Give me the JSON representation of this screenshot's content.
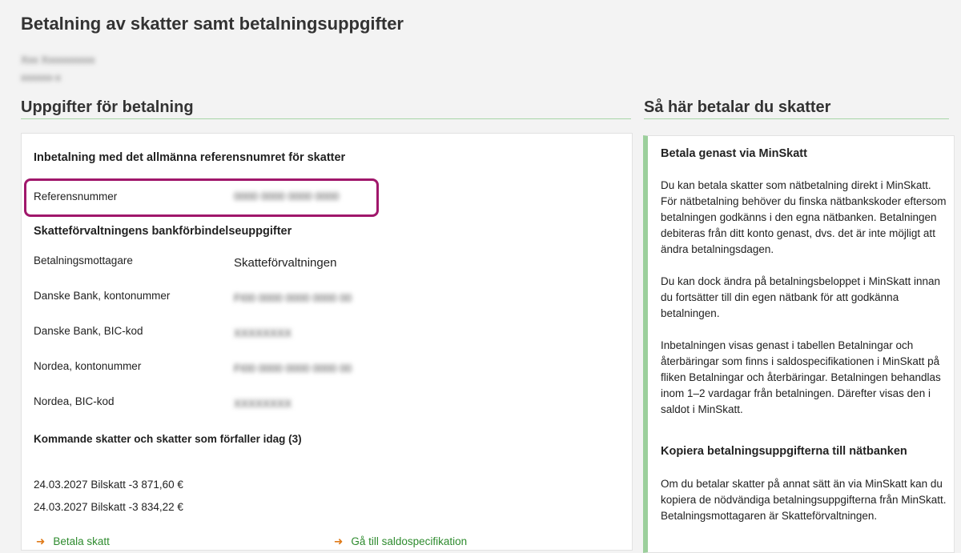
{
  "page": {
    "title": "Betalning av skatter samt betalningsuppgifter",
    "user_name_blurred": "Xxx Xxxxxxxxxx",
    "user_id_blurred": "xxxxxx-x"
  },
  "left": {
    "section_title": "Uppgifter för betalning",
    "reference_heading": "Inbetalning med det allmänna referensnumret för skatter",
    "reference_label": "Referensnummer",
    "reference_value_blurred": "0000 0000 0000 0000",
    "bank_heading": "Skatteförvaltningens bankförbindelseuppgifter",
    "bank_rows": [
      {
        "label": "Betalningsmottagare",
        "value": "Skatteförvaltningen"
      },
      {
        "label": "Danske Bank, kontonummer",
        "value": "FI00 0000 0000 0000 00"
      },
      {
        "label": "Danske Bank, BIC-kod",
        "value": "XXXXXXXX"
      },
      {
        "label": "Nordea, kontonummer",
        "value": "FI00 0000 0000 0000 00"
      },
      {
        "label": "Nordea, BIC-kod",
        "value": "XXXXXXXX"
      }
    ],
    "upcoming_heading": "Kommande skatter och skatter som förfaller idag (3)",
    "upcoming_items": [
      "24.03.2027 Bilskatt -3 871,60 €",
      "24.03.2027 Bilskatt -3 834,22 €"
    ],
    "links": [
      "Betala skatt",
      "Gå till saldospecifikation"
    ]
  },
  "right": {
    "section_title": "Så här betalar du skatter",
    "heading1": "Betala genast via MinSkatt",
    "para1": "Du kan betala skatter som nätbetalning direkt i MinSkatt. För nätbetalning behöver du finska nätbankskoder eftersom betalningen godkänns i den egna nätbanken. Betalningen debiteras från ditt konto genast, dvs. det är inte möjligt att ändra betalningsdagen.",
    "para2": "Du kan dock ändra på betalningsbeloppet i MinSkatt innan du fortsätter till din egen nätbank för att godkänna betalningen.",
    "para3": "Inbetalningen visas genast i tabellen Betalningar och återbäringar som finns i saldospecifikationen i MinSkatt på fliken Betalningar och återbäringar. Betalningen behandlas inom 1–2 vardagar från betalningen. Därefter visas den i saldot i MinSkatt.",
    "heading2": "Kopiera betalningsuppgifterna till nätbanken",
    "para4": "Om du betalar skatter på annat sätt än via MinSkatt kan du kopiera de nödvändiga betalningsuppgifterna från MinSkatt. Betalningsmottagaren är Skatteförvaltningen."
  },
  "colors": {
    "accent_green": "#9ccf9c",
    "highlight": "#a0176b",
    "link": "#2e8b2e",
    "link_arrow": "#e07b1a"
  }
}
